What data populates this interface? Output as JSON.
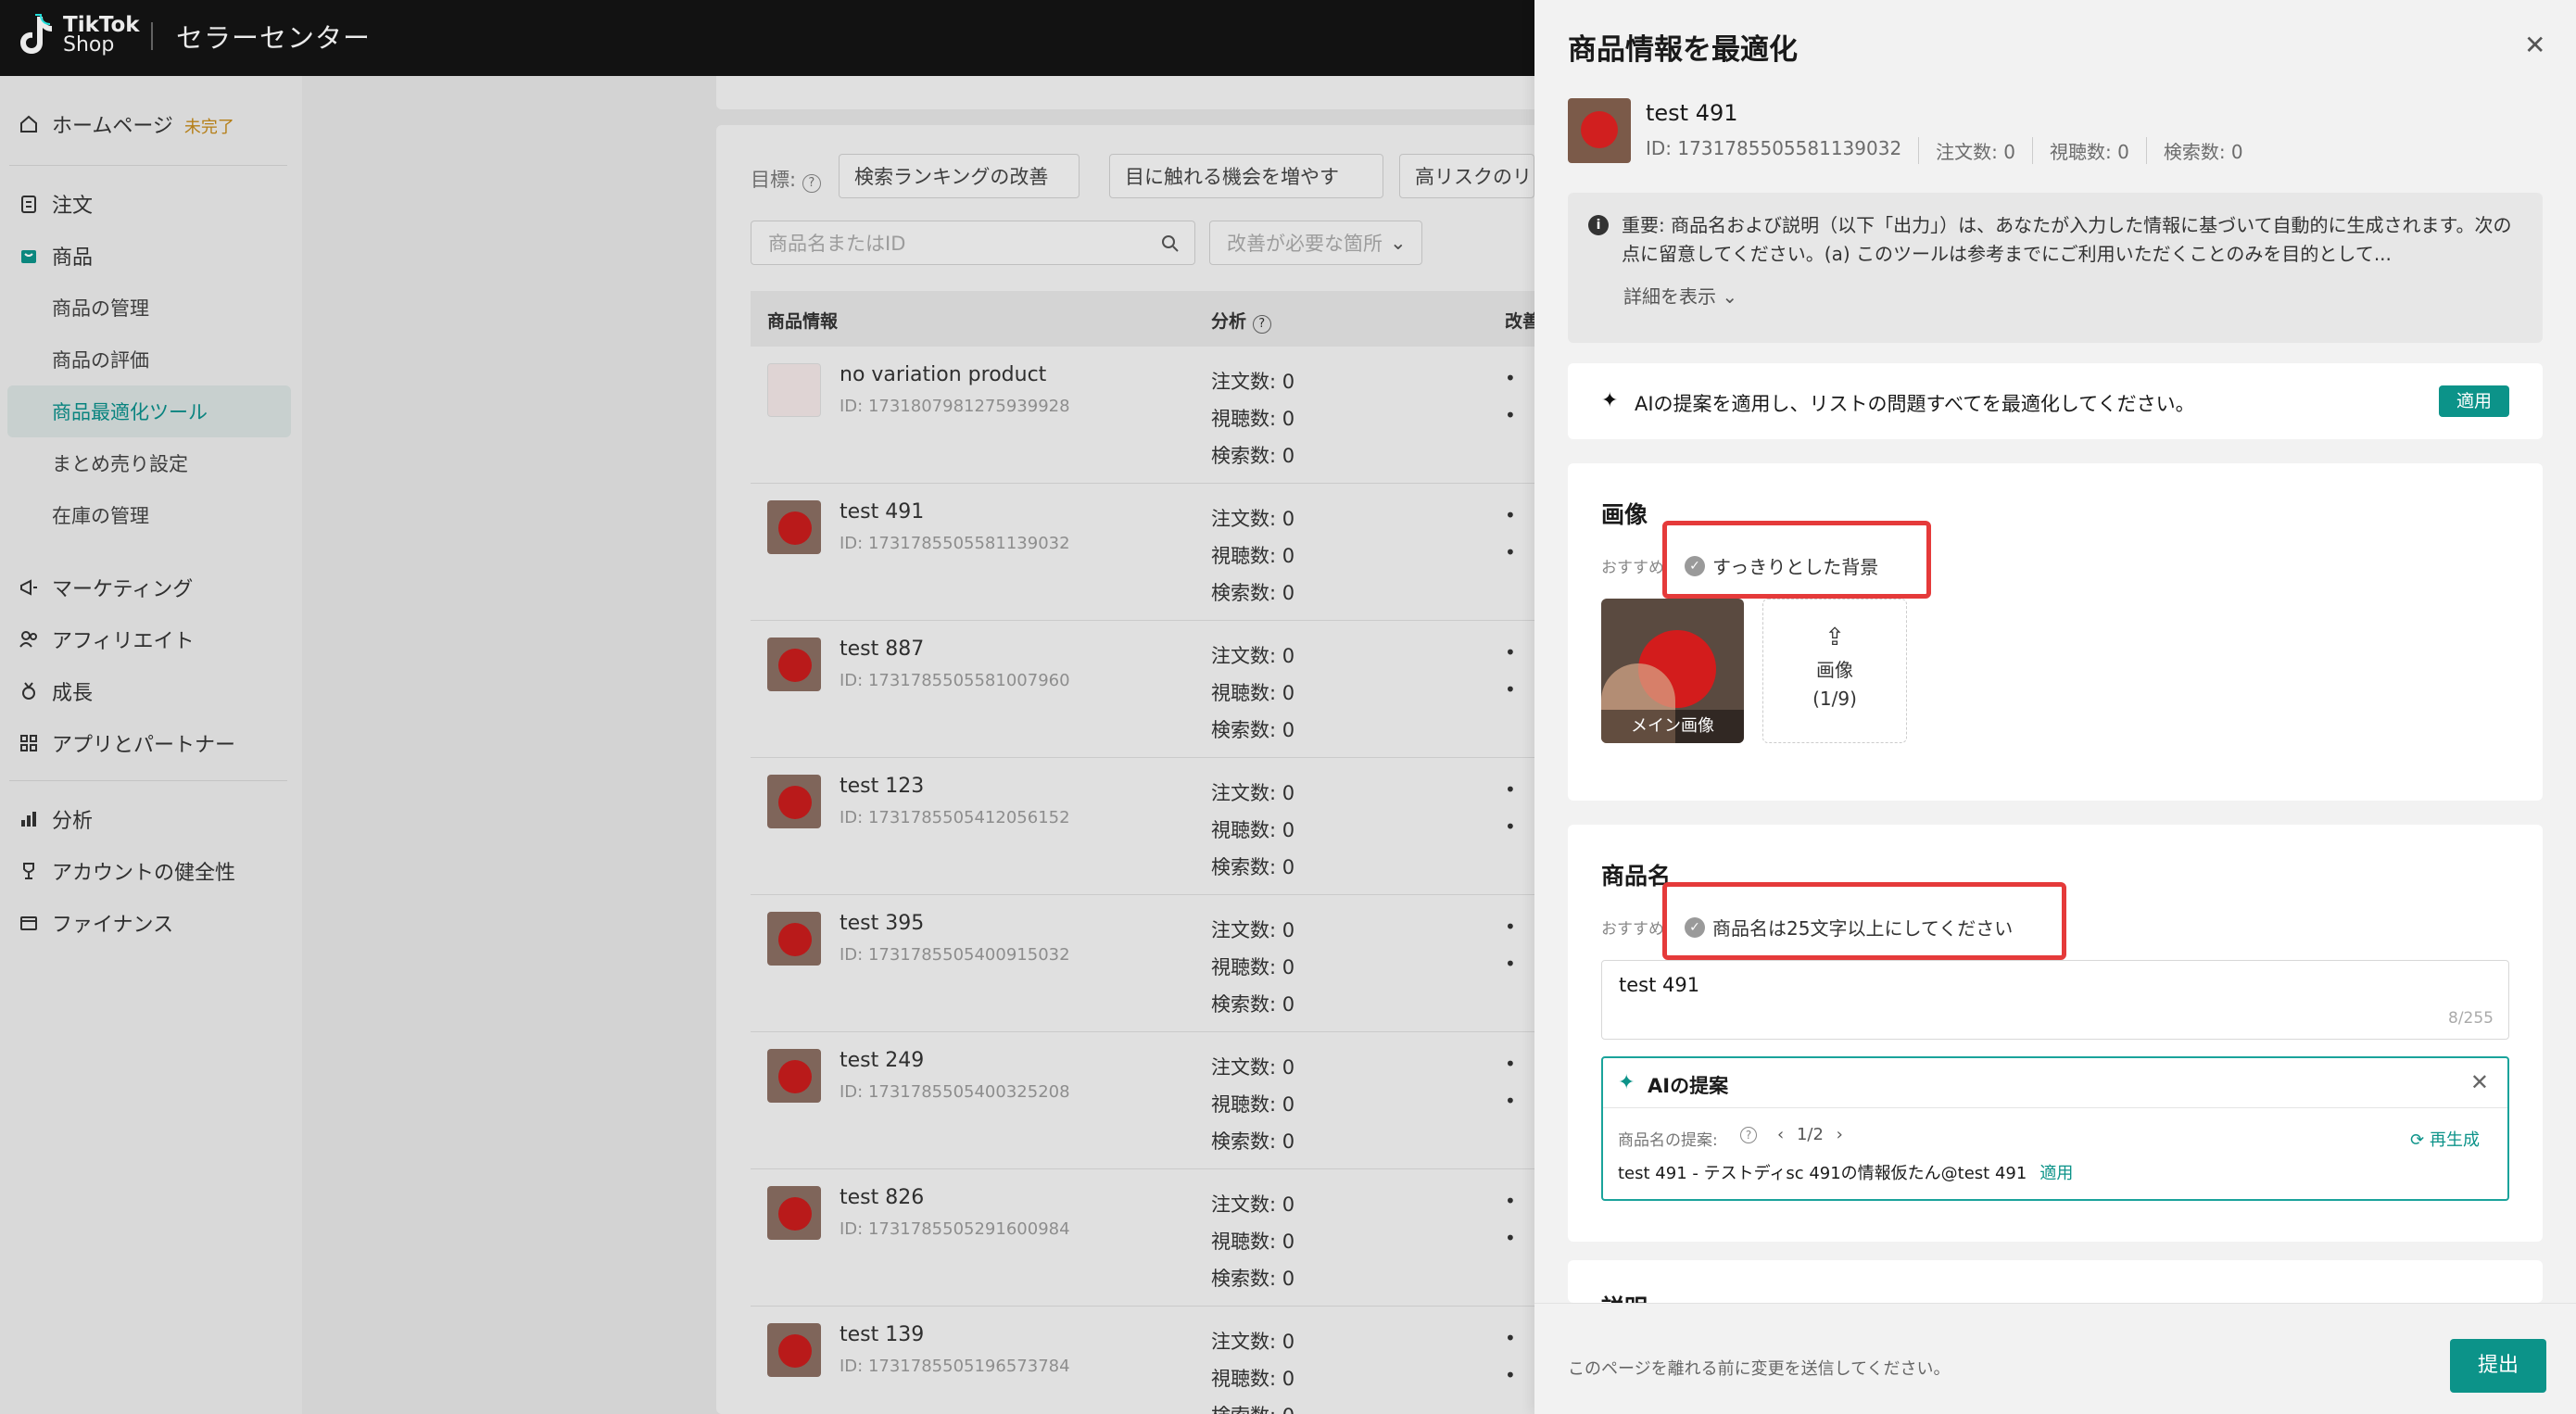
{
  "header": {
    "logo_line1": "TikTok",
    "logo_line2": "Shop",
    "title": "セラーセンター"
  },
  "sidebar": {
    "home": "ホームページ",
    "home_badge": "未完了",
    "orders": "注文",
    "products": "商品",
    "sub": [
      "商品の管理",
      "商品の評価",
      "商品最適化ツール",
      "まとめ売り設定",
      "在庫の管理"
    ],
    "marketing": "マーケティング",
    "affiliate": "アフィリエイト",
    "growth": "成長",
    "apps": "アプリとパートナー",
    "analytics": "分析",
    "account_health": "アカウントの健全性",
    "finance": "ファイナンス"
  },
  "main": {
    "goal_label": "目標:",
    "chips": [
      "検索ランキングの改善",
      "目に触れる機会を増やす",
      "高リスクのリ"
    ],
    "search_placeholder": "商品名またはID",
    "filter_placeholder": "改善が必要な箇所",
    "col_product": "商品情報",
    "col_analysis": "分析",
    "col_improve": "改善",
    "stat_labels": [
      "注文数: 0",
      "視聴数: 0",
      "検索数: 0"
    ],
    "products": [
      {
        "name": "no variation product",
        "id": "ID: 1731807981275939928"
      },
      {
        "name": "test 491",
        "id": "ID: 1731785505581139032"
      },
      {
        "name": "test 887",
        "id": "ID: 1731785505581007960"
      },
      {
        "name": "test 123",
        "id": "ID: 1731785505412056152"
      },
      {
        "name": "test 395",
        "id": "ID: 1731785505400915032"
      },
      {
        "name": "test 249",
        "id": "ID: 1731785505400325208"
      },
      {
        "name": "test 826",
        "id": "ID: 1731785505291600984"
      },
      {
        "name": "test 139",
        "id": "ID: 1731785505196573784"
      }
    ]
  },
  "drawer": {
    "title": "商品情報を最適化",
    "product_name": "test 491",
    "product_id": "ID: 1731785505581139032",
    "orders": "注文数: 0",
    "views": "視聴数: 0",
    "searches": "検索数: 0",
    "notice": "重要: 商品名および説明（以下「出力」）は、あなたが入力した情報に基づいて自動的に生成されます。次の点に留意してください。(a) このツールは参考までにご利用いただくことのみを目的として...",
    "show_more": "詳細を表示",
    "ai_apply_text": "AIの提案を適用し、リストの問題すべてを最適化してください。",
    "apply": "適用",
    "image_section": "画像",
    "rec_label": "おすすめ",
    "image_rec": "すっきりとした背景",
    "main_image_caption": "メイン画像",
    "upload_label": "画像",
    "upload_count": "(1/9)",
    "name_section": "商品名",
    "name_rec": "商品名は25文字以上にしてください",
    "name_value": "test 491",
    "name_count": "8/255",
    "ai_box_title": "AIの提案",
    "suggestion_label": "商品名の提案:",
    "pager": "1/2",
    "regenerate": "再生成",
    "suggestion_text": "test 491 - テストディsc 491の情報仮たん@test 491",
    "suggestion_apply": "適用",
    "desc_section": "説明",
    "footer_msg": "このページを離れる前に変更を送信してください。",
    "submit": "提出"
  }
}
